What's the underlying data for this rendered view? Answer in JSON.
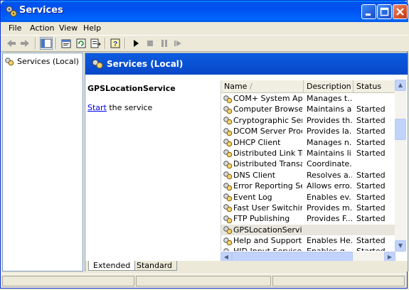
{
  "window": {
    "title": "Services",
    "minimize_icon": "minimize-icon",
    "maximize_icon": "maximize-icon",
    "close_icon": "close-icon"
  },
  "menu": [
    "File",
    "Action",
    "View",
    "Help"
  ],
  "tree": {
    "root_label": "Services (Local)"
  },
  "pane": {
    "header_title": "Services (Local)",
    "selected_service": "GPSLocationService",
    "start_link": "Start",
    "start_suffix": " the service"
  },
  "list": {
    "columns": [
      "Name",
      "Description",
      "Status"
    ],
    "sort_indicator": "/",
    "rows": [
      {
        "name": "COM+ System Appli...",
        "description": "Manages t...",
        "status": ""
      },
      {
        "name": "Computer Browser",
        "description": "Maintains a...",
        "status": "Started"
      },
      {
        "name": "Cryptographic Servi...",
        "description": "Provides th...",
        "status": "Started"
      },
      {
        "name": "DCOM Server Proce...",
        "description": "Provides la...",
        "status": "Started"
      },
      {
        "name": "DHCP Client",
        "description": "Manages n...",
        "status": "Started"
      },
      {
        "name": "Distributed Link Tra...",
        "description": "Maintains li...",
        "status": "Started"
      },
      {
        "name": "Distributed Transac...",
        "description": "Coordinate...",
        "status": ""
      },
      {
        "name": "DNS Client",
        "description": "Resolves a...",
        "status": "Started"
      },
      {
        "name": "Error Reporting Ser...",
        "description": "Allows erro...",
        "status": "Started"
      },
      {
        "name": "Event Log",
        "description": "Enables ev...",
        "status": "Started"
      },
      {
        "name": "Fast User Switching...",
        "description": "Provides m...",
        "status": "Started"
      },
      {
        "name": "FTP Publishing",
        "description": "Provides F...",
        "status": "Started"
      },
      {
        "name": "GPSLocationService",
        "description": "",
        "status": ""
      },
      {
        "name": "Help and Support",
        "description": "Enables He...",
        "status": "Started"
      },
      {
        "name": "HID Input Service",
        "description": "Enables g...",
        "status": "Started"
      }
    ]
  },
  "tabs": [
    "Extended",
    "Standard"
  ]
}
